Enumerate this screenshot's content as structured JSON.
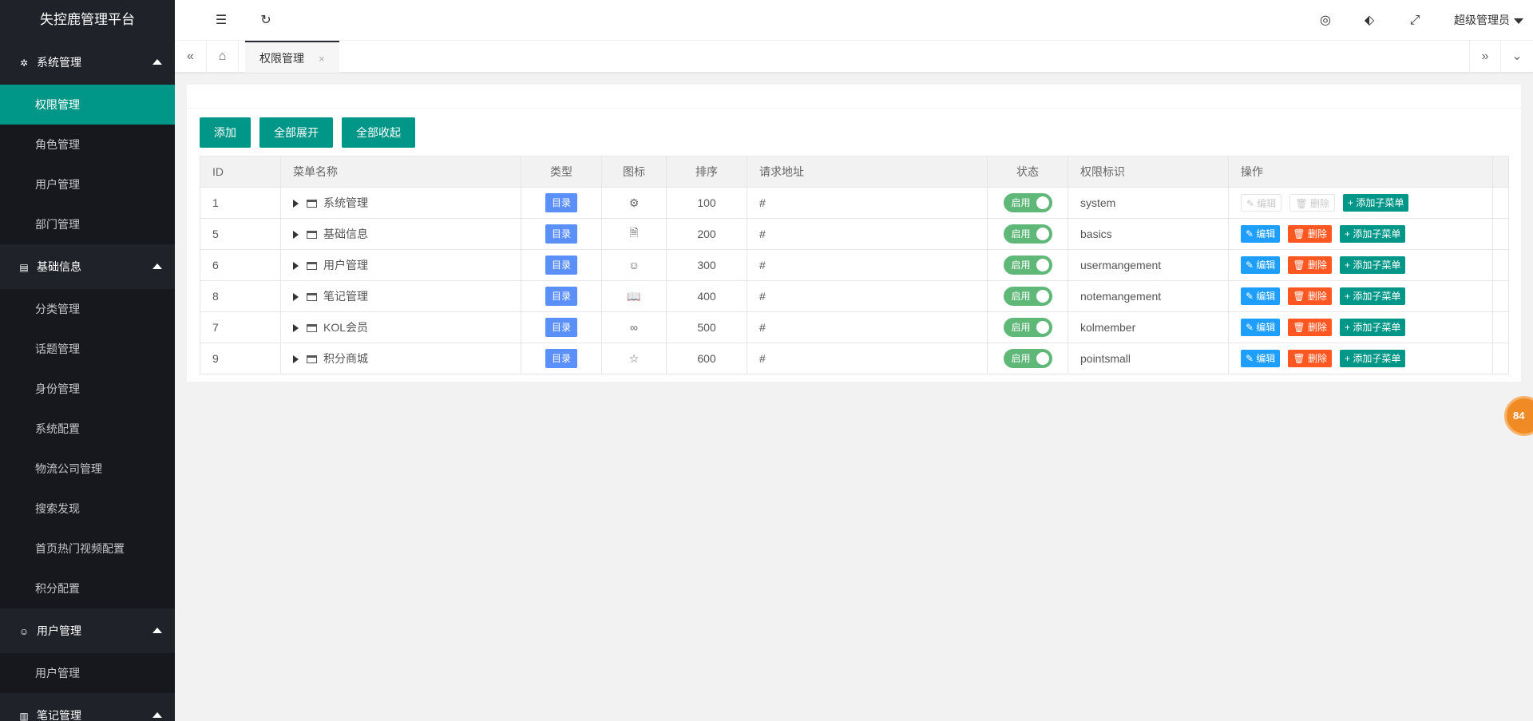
{
  "app": {
    "title": "失控鹿管理平台"
  },
  "sidebar": {
    "groups": [
      {
        "title": "系统管理",
        "icon": "gear-icon",
        "items": [
          {
            "label": "权限管理",
            "active": true
          },
          {
            "label": "角色管理"
          },
          {
            "label": "用户管理"
          },
          {
            "label": "部门管理"
          }
        ]
      },
      {
        "title": "基础信息",
        "icon": "doc-icon",
        "items": [
          {
            "label": "分类管理"
          },
          {
            "label": "话题管理"
          },
          {
            "label": "身份管理"
          },
          {
            "label": "系统配置"
          },
          {
            "label": "物流公司管理"
          },
          {
            "label": "搜索发现"
          },
          {
            "label": "首页热门视频配置"
          },
          {
            "label": "积分配置"
          }
        ]
      },
      {
        "title": "用户管理",
        "icon": "user-icon",
        "items": [
          {
            "label": "用户管理"
          }
        ]
      },
      {
        "title": "笔记管理",
        "icon": "book-icon",
        "items": []
      }
    ]
  },
  "header": {
    "user": "超级管理员"
  },
  "tabs": {
    "items": [
      {
        "label": "权限管理",
        "close": "×"
      }
    ]
  },
  "toolbar": {
    "add": "添加",
    "expand_all": "全部展开",
    "collapse_all": "全部收起"
  },
  "table": {
    "columns": [
      "ID",
      "菜单名称",
      "类型",
      "图标",
      "排序",
      "请求地址",
      "状态",
      "权限标识",
      "操作"
    ],
    "rows": [
      {
        "id": "1",
        "name": "系统管理",
        "type": "目录",
        "icon": "gear-icon",
        "icon_glyph": "⚙",
        "sort": "100",
        "url": "#",
        "status": "启用",
        "perm": "system",
        "disabled_ops": true
      },
      {
        "id": "5",
        "name": "基础信息",
        "type": "目录",
        "icon": "doc-icon",
        "icon_glyph": "🗎",
        "sort": "200",
        "url": "#",
        "status": "启用",
        "perm": "basics",
        "disabled_ops": false
      },
      {
        "id": "6",
        "name": "用户管理",
        "type": "目录",
        "icon": "user-icon",
        "icon_glyph": "☺",
        "sort": "300",
        "url": "#",
        "status": "启用",
        "perm": "usermangement",
        "disabled_ops": false
      },
      {
        "id": "8",
        "name": "笔记管理",
        "type": "目录",
        "icon": "book-icon",
        "icon_glyph": "📖",
        "sort": "400",
        "url": "#",
        "status": "启用",
        "perm": "notemangement",
        "disabled_ops": false
      },
      {
        "id": "7",
        "name": "KOL会员",
        "type": "目录",
        "icon": "infinity-icon",
        "icon_glyph": "∞",
        "sort": "500",
        "url": "#",
        "status": "启用",
        "perm": "kolmember",
        "disabled_ops": false
      },
      {
        "id": "9",
        "name": "积分商城",
        "type": "目录",
        "icon": "star-icon",
        "icon_glyph": "☆",
        "sort": "600",
        "url": "#",
        "status": "启用",
        "perm": "pointsmall",
        "disabled_ops": false
      }
    ],
    "ops": {
      "edit": "编辑",
      "delete": "删除",
      "add_child": "添加子菜单"
    }
  },
  "float_ball": {
    "text": "84"
  },
  "colors": {
    "accent": "#009688",
    "sidebar": "#20222a",
    "edit": "#1e9fff",
    "delete": "#ff5722",
    "badge": "#5b8ff9",
    "switch": "#5fb878"
  }
}
